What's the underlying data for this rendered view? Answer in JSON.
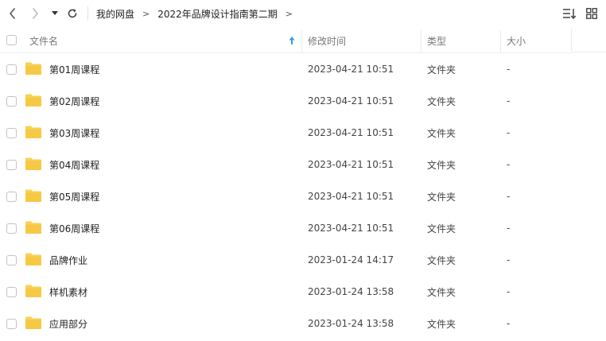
{
  "breadcrumb": {
    "root": "我的网盘",
    "current": "2022年品牌设计指南第二期",
    "separator": ">"
  },
  "icons": {
    "back": "chevron-left-icon",
    "forward": "chevron-right-icon",
    "history": "caret-down-icon",
    "refresh": "refresh-icon",
    "sort": "sort-list-icon",
    "view": "grid-view-icon",
    "folder": "folder-icon"
  },
  "colors": {
    "folder": "#F8D256",
    "sort_arrow": "#3B9CE0"
  },
  "table": {
    "headers": {
      "name": "文件名",
      "modified": "修改时间",
      "type": "类型",
      "size": "大小"
    },
    "sort": {
      "column": "name",
      "direction": "ascending"
    },
    "rows": [
      {
        "name": "第01周课程",
        "modified": "2023-04-21 10:51",
        "type": "文件夹",
        "size": "-"
      },
      {
        "name": "第02周课程",
        "modified": "2023-04-21 10:51",
        "type": "文件夹",
        "size": "-"
      },
      {
        "name": "第03周课程",
        "modified": "2023-04-21 10:51",
        "type": "文件夹",
        "size": "-"
      },
      {
        "name": "第04周课程",
        "modified": "2023-04-21 10:51",
        "type": "文件夹",
        "size": "-"
      },
      {
        "name": "第05周课程",
        "modified": "2023-04-21 10:51",
        "type": "文件夹",
        "size": "-"
      },
      {
        "name": "第06周课程",
        "modified": "2023-04-21 10:51",
        "type": "文件夹",
        "size": "-"
      },
      {
        "name": "品牌作业",
        "modified": "2023-01-24 14:17",
        "type": "文件夹",
        "size": "-"
      },
      {
        "name": "样机素材",
        "modified": "2023-01-24 13:58",
        "type": "文件夹",
        "size": "-"
      },
      {
        "name": "应用部分",
        "modified": "2023-01-24 13:58",
        "type": "文件夹",
        "size": "-"
      }
    ]
  }
}
